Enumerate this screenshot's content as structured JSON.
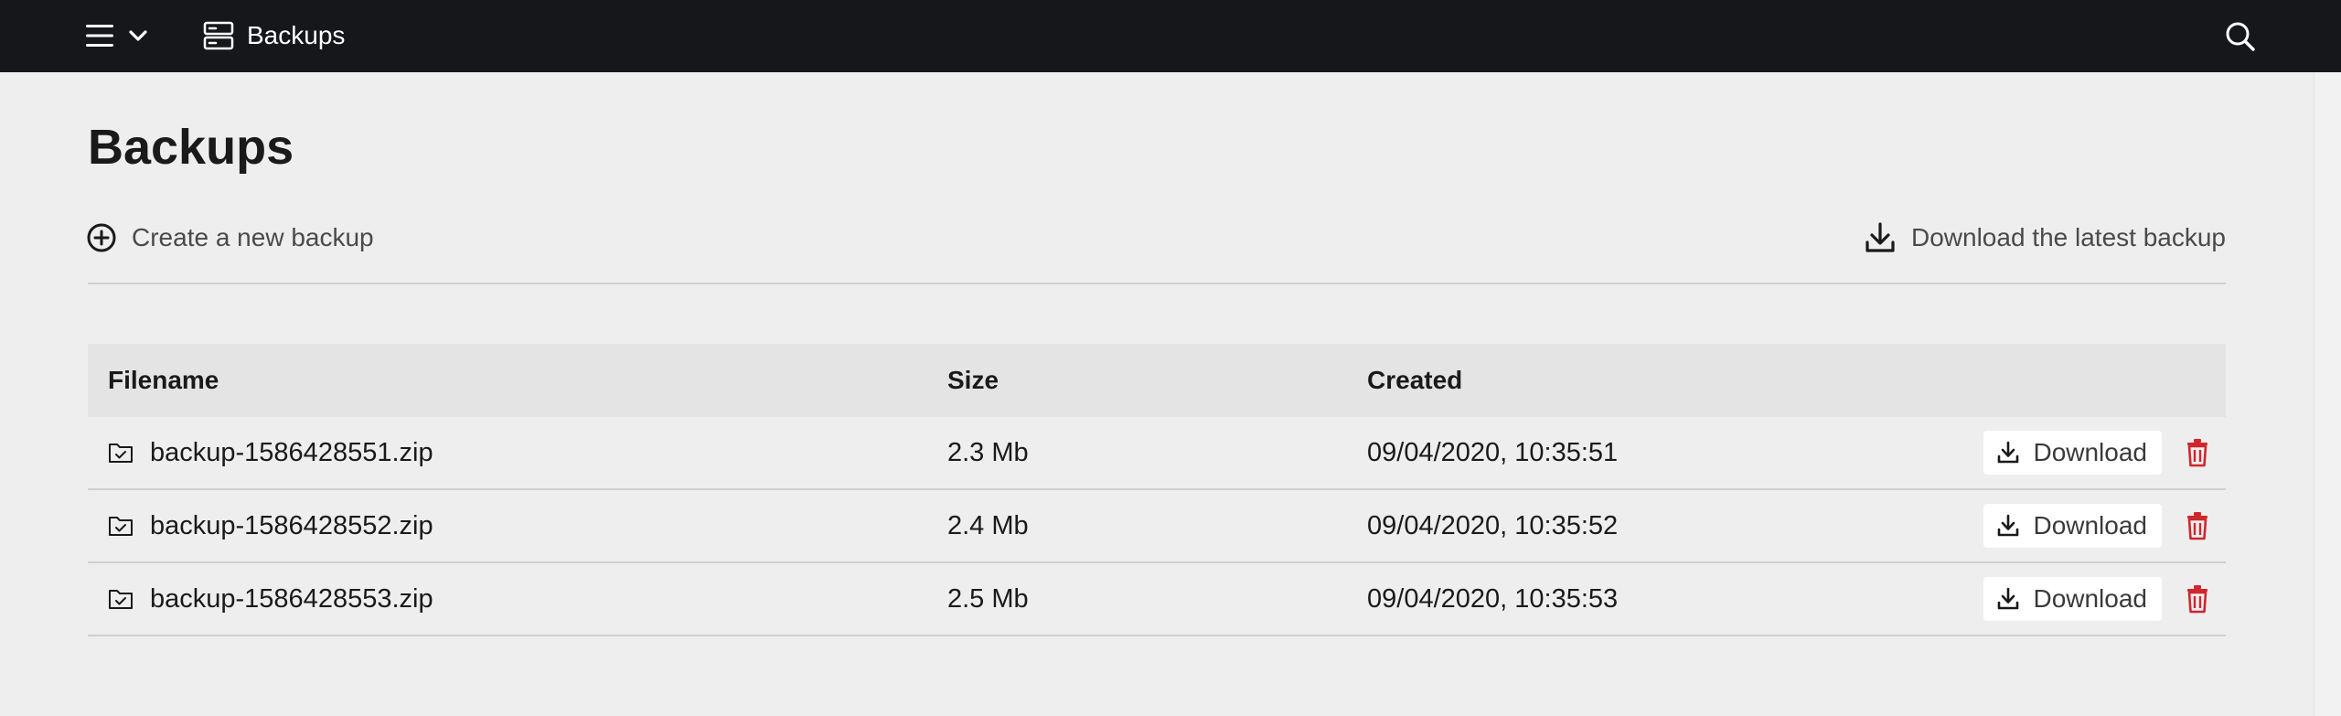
{
  "topbar": {
    "title": "Backups",
    "icons": {
      "menu": "hamburger-icon",
      "caret": "chevron-down-icon",
      "section": "server-icon",
      "search": "search-icon"
    }
  },
  "page": {
    "title": "Backups",
    "create_label": "Create a new backup",
    "download_latest_label": "Download the latest backup"
  },
  "table": {
    "headers": [
      "Filename",
      "Size",
      "Created"
    ],
    "download_label": "Download",
    "rows": [
      {
        "filename": "backup-1586428551.zip",
        "size": "2.3 Mb",
        "created": "09/04/2020, 10:35:51"
      },
      {
        "filename": "backup-1586428552.zip",
        "size": "2.4 Mb",
        "created": "09/04/2020, 10:35:52"
      },
      {
        "filename": "backup-1586428553.zip",
        "size": "2.5 Mb",
        "created": "09/04/2020, 10:35:53"
      }
    ]
  },
  "colors": {
    "topbar_bg": "#16171b",
    "page_bg": "#eeeeee",
    "header_row_bg": "#e4e4e4",
    "delete_red": "#d0262d"
  }
}
